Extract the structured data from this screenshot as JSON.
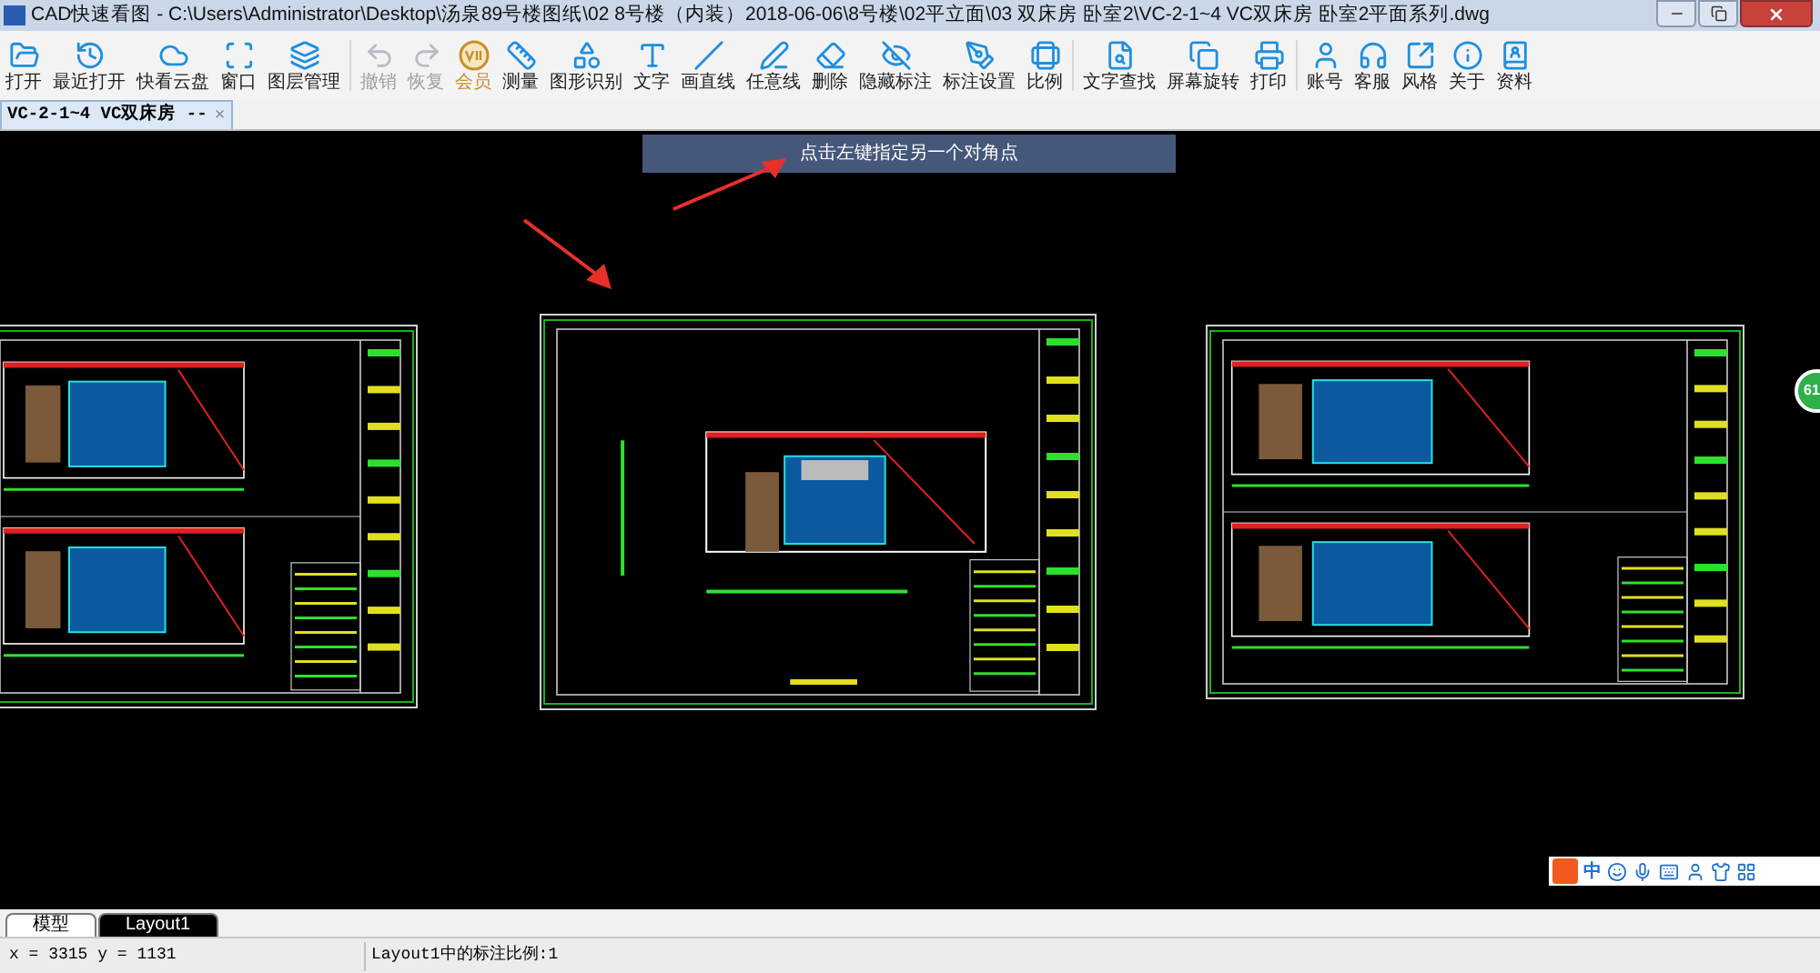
{
  "window": {
    "title": "CAD快速看图 - C:\\Users\\Administrator\\Desktop\\汤泉89号楼图纸\\02 8号楼（内装）2018-06-06\\8号楼\\02平立面\\03 双床房 卧室2\\VC-2-1~4 VC双床房 卧室2平面系列.dwg"
  },
  "toolbar": [
    [
      {
        "label": "打开",
        "disabled": false,
        "kind": "tool"
      },
      {
        "label": "最近打开",
        "disabled": false,
        "kind": "tool"
      },
      {
        "label": "快看云盘",
        "disabled": false,
        "kind": "tool"
      },
      {
        "label": "窗口",
        "disabled": false,
        "kind": "tool"
      },
      {
        "label": "图层管理",
        "disabled": false,
        "kind": "tool"
      }
    ],
    [
      {
        "label": "撤销",
        "disabled": true,
        "kind": "tool"
      },
      {
        "label": "恢复",
        "disabled": true,
        "kind": "tool"
      },
      {
        "label": "会员",
        "disabled": false,
        "kind": "vip"
      },
      {
        "label": "测量",
        "disabled": false,
        "kind": "tool"
      },
      {
        "label": "图形识别",
        "disabled": false,
        "kind": "tool"
      },
      {
        "label": "文字",
        "disabled": false,
        "kind": "tool"
      },
      {
        "label": "画直线",
        "disabled": false,
        "kind": "tool"
      },
      {
        "label": "任意线",
        "disabled": false,
        "kind": "tool"
      },
      {
        "label": "删除",
        "disabled": false,
        "kind": "tool"
      },
      {
        "label": "隐藏标注",
        "disabled": false,
        "kind": "tool"
      },
      {
        "label": "标注设置",
        "disabled": false,
        "kind": "tool"
      },
      {
        "label": "比例",
        "disabled": false,
        "kind": "tool"
      }
    ],
    [
      {
        "label": "文字查找",
        "disabled": false,
        "kind": "tool"
      },
      {
        "label": "屏幕旋转",
        "disabled": false,
        "kind": "tool"
      },
      {
        "label": "打印",
        "disabled": false,
        "kind": "tool"
      }
    ],
    [
      {
        "label": "账号",
        "disabled": false,
        "kind": "tool"
      },
      {
        "label": "客服",
        "disabled": false,
        "kind": "tool"
      },
      {
        "label": "风格",
        "disabled": false,
        "kind": "tool"
      },
      {
        "label": "关于",
        "disabled": false,
        "kind": "tool"
      },
      {
        "label": "资料",
        "disabled": false,
        "kind": "tool"
      }
    ]
  ],
  "doc_tabs": [
    {
      "label": "VC-2-1~4 VC双床房 --",
      "selected": true,
      "close": "×"
    }
  ],
  "canvas": {
    "prompt": "点击左键指定另一个对角点",
    "side_badge": "61",
    "ime_label": "中"
  },
  "layout_tabs": [
    {
      "label": "模型",
      "selected": false
    },
    {
      "label": "Layout1",
      "selected": true
    }
  ],
  "status_bar": {
    "coords": "x = 3315 y = 1131",
    "scale": "Layout1中的标注比例:1"
  }
}
